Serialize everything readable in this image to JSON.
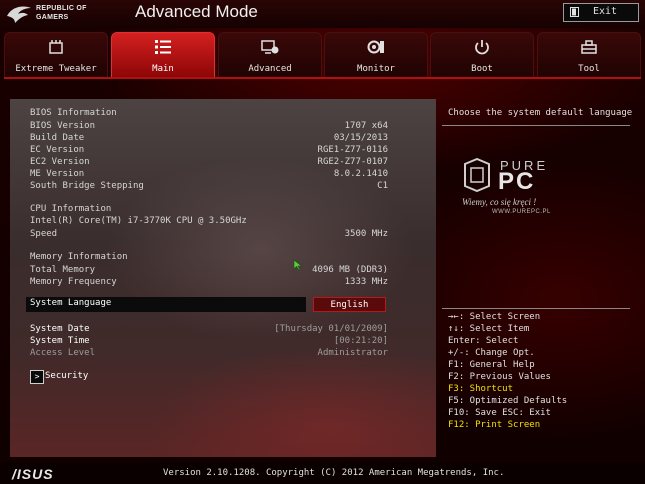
{
  "header": {
    "brand_line1": "REPUBLIC OF",
    "brand_line2": "GAMERS",
    "mode_title": "Advanced Mode",
    "exit_label": "Exit"
  },
  "tabs": [
    {
      "label": "Extreme Tweaker",
      "icon": "tweaker-icon",
      "active": false
    },
    {
      "label": "Main",
      "icon": "list-icon",
      "active": true
    },
    {
      "label": "Advanced",
      "icon": "advanced-icon",
      "active": false
    },
    {
      "label": "Monitor",
      "icon": "monitor-icon",
      "active": false
    },
    {
      "label": "Boot",
      "icon": "power-icon",
      "active": false
    },
    {
      "label": "Tool",
      "icon": "tool-icon",
      "active": false
    }
  ],
  "bios": {
    "heading": "BIOS Information",
    "rows": [
      {
        "label": "BIOS Version",
        "value": "1707 x64"
      },
      {
        "label": "Build Date",
        "value": "03/15/2013"
      },
      {
        "label": "EC Version",
        "value": "RGE1-Z77-0116"
      },
      {
        "label": "EC2 Version",
        "value": "RGE2-Z77-0107"
      },
      {
        "label": "ME Version",
        "value": "8.0.2.1410"
      },
      {
        "label": "South Bridge Stepping",
        "value": "C1"
      }
    ]
  },
  "cpu": {
    "heading": "CPU Information",
    "model": "Intel(R) Core(TM) i7-3770K CPU @ 3.50GHz",
    "speed_label": "Speed",
    "speed_value": "3500 MHz"
  },
  "memory": {
    "heading": "Memory Information",
    "rows": [
      {
        "label": "Total Memory",
        "value": "4096 MB (DDR3)"
      },
      {
        "label": "Memory Frequency",
        "value": "1333 MHz"
      }
    ]
  },
  "language": {
    "label": "System Language",
    "value": "English"
  },
  "system": {
    "date_label": "System Date",
    "date_value": "[Thursday 01/01/2009]",
    "time_label": "System Time",
    "time_value": "[00:21:20]",
    "access_label": "Access Level",
    "access_value": "Administrator"
  },
  "security": {
    "arrow": ">",
    "label": "Security"
  },
  "help": {
    "description": "Choose the system default language"
  },
  "watermark": {
    "pure": "PURE",
    "pc": "PC",
    "tagline": "Wiemy, co się kręci !",
    "url": "WWW.PUREPC.PL"
  },
  "keys": [
    {
      "text": "→←: Select Screen",
      "highlight": false
    },
    {
      "text": "↑↓: Select Item",
      "highlight": false
    },
    {
      "text": "Enter: Select",
      "highlight": false
    },
    {
      "text": "+/-: Change Opt.",
      "highlight": false
    },
    {
      "text": "F1: General Help",
      "highlight": false
    },
    {
      "text": "F2: Previous Values",
      "highlight": false
    },
    {
      "text": "F3: Shortcut",
      "highlight": true
    },
    {
      "text": "F5: Optimized Defaults",
      "highlight": false
    },
    {
      "text": "F10: Save  ESC: Exit",
      "highlight": false
    },
    {
      "text": "F12: Print Screen",
      "highlight": true
    }
  ],
  "footer": {
    "brand": "/ISUS",
    "version": "Version 2.10.1208. Copyright (C) 2012 American Megatrends, Inc."
  },
  "colors": {
    "accent": "#d52020",
    "highlight_text": "#f0e000"
  }
}
